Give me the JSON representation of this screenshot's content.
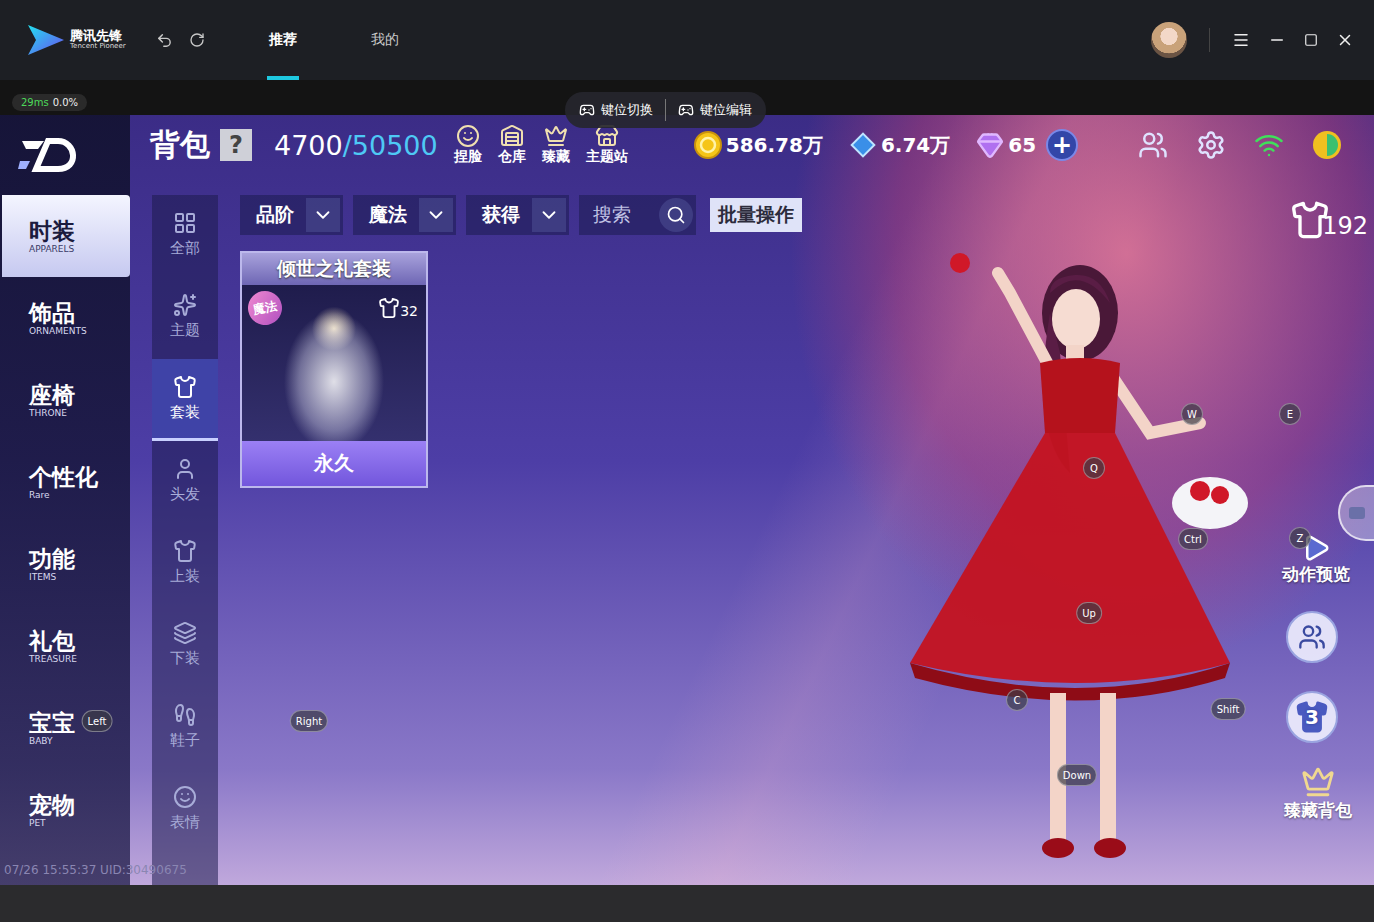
{
  "app": {
    "name": "腾讯先锋",
    "subtitle": "Tencent Pioneer",
    "tabs": [
      {
        "label": "推荐",
        "selected": true
      },
      {
        "label": "我的",
        "selected": false
      }
    ]
  },
  "latency": {
    "ping": "29ms",
    "loss": "0.0%"
  },
  "overlay_buttons": [
    "键位切换",
    "键位编辑"
  ],
  "header": {
    "title": "背包",
    "help": "?",
    "capacity_used": "4700",
    "capacity_total": "/50500",
    "shortcuts": [
      "捏脸",
      "仓库",
      "臻藏",
      "主题站"
    ],
    "currencies": [
      {
        "value": "586.78万"
      },
      {
        "value": "6.74万"
      },
      {
        "value": "65"
      }
    ],
    "add": "+"
  },
  "categories": [
    {
      "label": "时装",
      "sub": "APPARELS",
      "selected": true
    },
    {
      "label": "饰品",
      "sub": "ORNAMENTS",
      "selected": false
    },
    {
      "label": "座椅",
      "sub": "THRONE",
      "selected": false
    },
    {
      "label": "个性化",
      "sub": "Rare",
      "selected": false
    },
    {
      "label": "功能",
      "sub": "ITEMS",
      "selected": false
    },
    {
      "label": "礼包",
      "sub": "TREASURE",
      "selected": false
    },
    {
      "label": "宝宝",
      "sub": "BABY",
      "selected": false
    },
    {
      "label": "宠物",
      "sub": "PET",
      "selected": false
    }
  ],
  "subcategories": [
    {
      "label": "全部",
      "selected": false
    },
    {
      "label": "主题",
      "selected": false
    },
    {
      "label": "套装",
      "selected": true
    },
    {
      "label": "头发",
      "selected": false
    },
    {
      "label": "上装",
      "selected": false
    },
    {
      "label": "下装",
      "selected": false
    },
    {
      "label": "鞋子",
      "selected": false
    },
    {
      "label": "表情",
      "selected": false
    }
  ],
  "filters": [
    {
      "label": "品阶"
    },
    {
      "label": "魔法"
    },
    {
      "label": "获得"
    }
  ],
  "search": {
    "placeholder": "搜索"
  },
  "batch": "批量操作",
  "items": [
    {
      "name": "倾世之礼套装",
      "badge": "魔法",
      "count": "32",
      "duration": "永久"
    }
  ],
  "outfit_count": "192",
  "side_actions": [
    {
      "kind": "labeled",
      "label": "动作预览"
    },
    {
      "kind": "icon"
    },
    {
      "kind": "number",
      "label": "3"
    },
    {
      "kind": "labeled",
      "label": "臻藏背包"
    }
  ],
  "key_hints": [
    "W",
    "E",
    "Q",
    "Ctrl",
    "Z",
    "Up",
    "C",
    "Shift",
    "Down",
    "Left",
    "Right"
  ],
  "footer": {
    "timestamp": "07/26 15:55:37 UID:30490675"
  }
}
